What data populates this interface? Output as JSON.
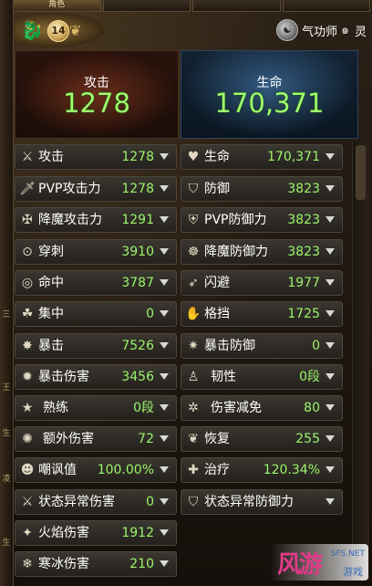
{
  "tabs": [
    {
      "label": "角色"
    },
    {
      "label": ""
    },
    {
      "label": ""
    },
    {
      "label": ""
    }
  ],
  "header": {
    "level": "14",
    "class_name": "气功师",
    "soul_name": "灵"
  },
  "summary": {
    "attack_label": "攻击",
    "attack_value": "1278",
    "life_label": "生命",
    "life_value": "170,371"
  },
  "left_stats": [
    {
      "label": "攻击",
      "value": "1278",
      "icon": "crossed-swords-icon"
    },
    {
      "label": "PVP攻击力",
      "value": "1278",
      "icon": "sword-icon"
    },
    {
      "label": "降魔攻击力",
      "value": "1291",
      "icon": "demon-sword-icon"
    },
    {
      "label": "穿刺",
      "value": "3910",
      "icon": "pierce-icon"
    },
    {
      "label": "命中",
      "value": "3787",
      "icon": "target-icon"
    },
    {
      "label": "集中",
      "value": "0",
      "icon": "focus-icon"
    },
    {
      "label": "暴击",
      "value": "7526",
      "icon": "critical-icon"
    },
    {
      "label": "暴击伤害",
      "value": "3456",
      "icon": "critical-damage-icon"
    },
    {
      "label": "熟练",
      "value": "0段",
      "icon": "mastery-icon"
    },
    {
      "label": "额外伤害",
      "value": "72",
      "icon": "extra-damage-icon"
    },
    {
      "label": "嘲讽值",
      "value": "100.00%",
      "icon": "taunt-icon"
    },
    {
      "label": "状态异常伤害",
      "value": "0",
      "icon": "status-damage-icon"
    },
    {
      "label": "火焰伤害",
      "value": "1912",
      "icon": "flame-icon"
    },
    {
      "label": "寒冰伤害",
      "value": "210",
      "icon": "frost-icon"
    }
  ],
  "right_stats": [
    {
      "label": "生命",
      "value": "170,371",
      "icon": "heart-icon"
    },
    {
      "label": "防御",
      "value": "3823",
      "icon": "shield-icon"
    },
    {
      "label": "PVP防御力",
      "value": "3823",
      "icon": "pvp-shield-icon"
    },
    {
      "label": "降魔防御力",
      "value": "3823",
      "icon": "demon-shield-icon"
    },
    {
      "label": "闪避",
      "value": "1977",
      "icon": "evade-icon"
    },
    {
      "label": "格挡",
      "value": "1725",
      "icon": "block-icon"
    },
    {
      "label": "暴击防御",
      "value": "0",
      "icon": "critical-defense-icon"
    },
    {
      "label": "韧性",
      "value": "0段",
      "icon": "tenacity-icon"
    },
    {
      "label": "伤害减免",
      "value": "80",
      "icon": "damage-reduction-icon"
    },
    {
      "label": "恢复",
      "value": "255",
      "icon": "recovery-icon"
    },
    {
      "label": "治疗",
      "value": "120.34%",
      "icon": "healing-icon"
    },
    {
      "label": "状态异常防御力",
      "value": "",
      "icon": "status-defense-icon"
    }
  ],
  "watermark": {
    "logo": "风游",
    "site": "SFS.NET",
    "sub": "游戏"
  },
  "colors": {
    "value_green": "#9cf56a",
    "summary_green": "#9dff6a",
    "label_white": "#ffffff"
  }
}
